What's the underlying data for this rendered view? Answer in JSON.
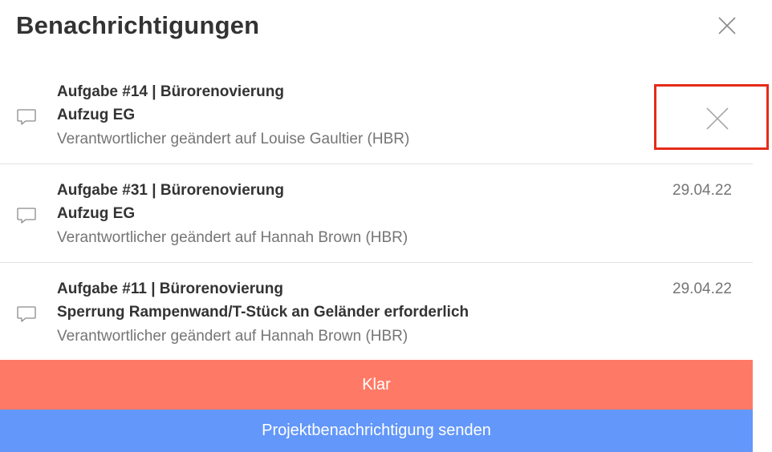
{
  "header": {
    "title": "Benachrichtigungen",
    "close_icon": "close-icon"
  },
  "notifications": [
    {
      "task": "Aufgabe #14 | Bürorenovierung",
      "subject": "Aufzug EG",
      "description": "Verantwortlicher geändert auf Louise Gaultier (HBR)",
      "date": "",
      "icon": "comment-icon",
      "dismiss_icon": "close-icon"
    },
    {
      "task": "Aufgabe #31 | Bürorenovierung",
      "subject": "Aufzug EG",
      "description": "Verantwortlicher geändert auf Hannah Brown (HBR)",
      "date": "29.04.22",
      "icon": "comment-icon"
    },
    {
      "task": "Aufgabe #11 | Bürorenovierung",
      "subject": "Sperrung Rampenwand/T-Stück an Geländer erforderlich",
      "description": "Verantwortlicher geändert auf Hannah Brown (HBR)",
      "date": "29.04.22",
      "icon": "comment-icon"
    }
  ],
  "footer": {
    "clear_label": "Klar",
    "send_label": "Projektbenachrichtigung senden"
  },
  "colors": {
    "clear_button": "#ff7a66",
    "send_button": "#6397f9",
    "highlight": "#e52b1a"
  }
}
